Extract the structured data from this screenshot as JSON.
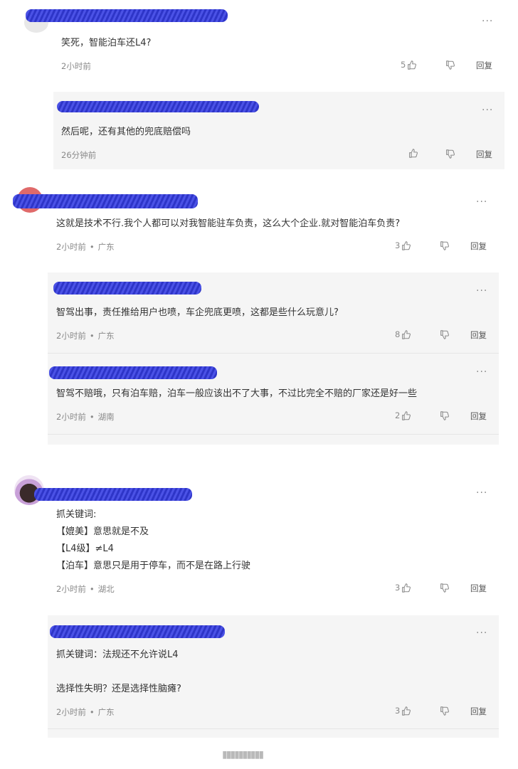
{
  "more_label": "···",
  "reply_label": "回复",
  "icons": {
    "like": "thumbs-up-icon",
    "dislike": "thumbs-down-icon",
    "more": "more-icon"
  },
  "colors": {
    "redact": "#2e35c8",
    "panel": "#f5f5f5",
    "meta": "#8a8a8a"
  },
  "comments": [
    {
      "text": "笑死，智能泊车还L4?",
      "time": "2小时前",
      "location": "",
      "likes": "5"
    },
    {
      "text": "然后呢，还有其他的兜底赔偿吗",
      "time": "26分钟前",
      "location": "",
      "likes": ""
    },
    {
      "text": "这就是技术不行.我个人都可以对我智能驻车负责，这么大个企业.就对智能泊车负责?",
      "time": "2小时前",
      "location": "广东",
      "likes": "3"
    },
    {
      "text": "智驾出事，责任推给用户也喷，车企兜底更喷，这都是些什么玩意儿?",
      "time": "2小时前",
      "location": "广东",
      "likes": "8"
    },
    {
      "text": "智驾不赔哦，只有泊车赔，泊车一般应该出不了大事，不过比完全不赔的厂家还是好一些",
      "time": "2小时前",
      "location": "湖南",
      "likes": "2"
    },
    {
      "lines": [
        "抓关键词:",
        "【媲美】意思就是不及",
        "【L4级】≠L4",
        "【泊车】意思只是用于停车，而不是在路上行驶"
      ],
      "time": "2小时前",
      "location": "湖北",
      "likes": "3"
    },
    {
      "lines": [
        "抓关键词：法规还不允许说L4",
        "",
        "选择性失明？还是选择性脑瘫?"
      ],
      "time": "2小时前",
      "location": "广东",
      "likes": "3"
    }
  ]
}
